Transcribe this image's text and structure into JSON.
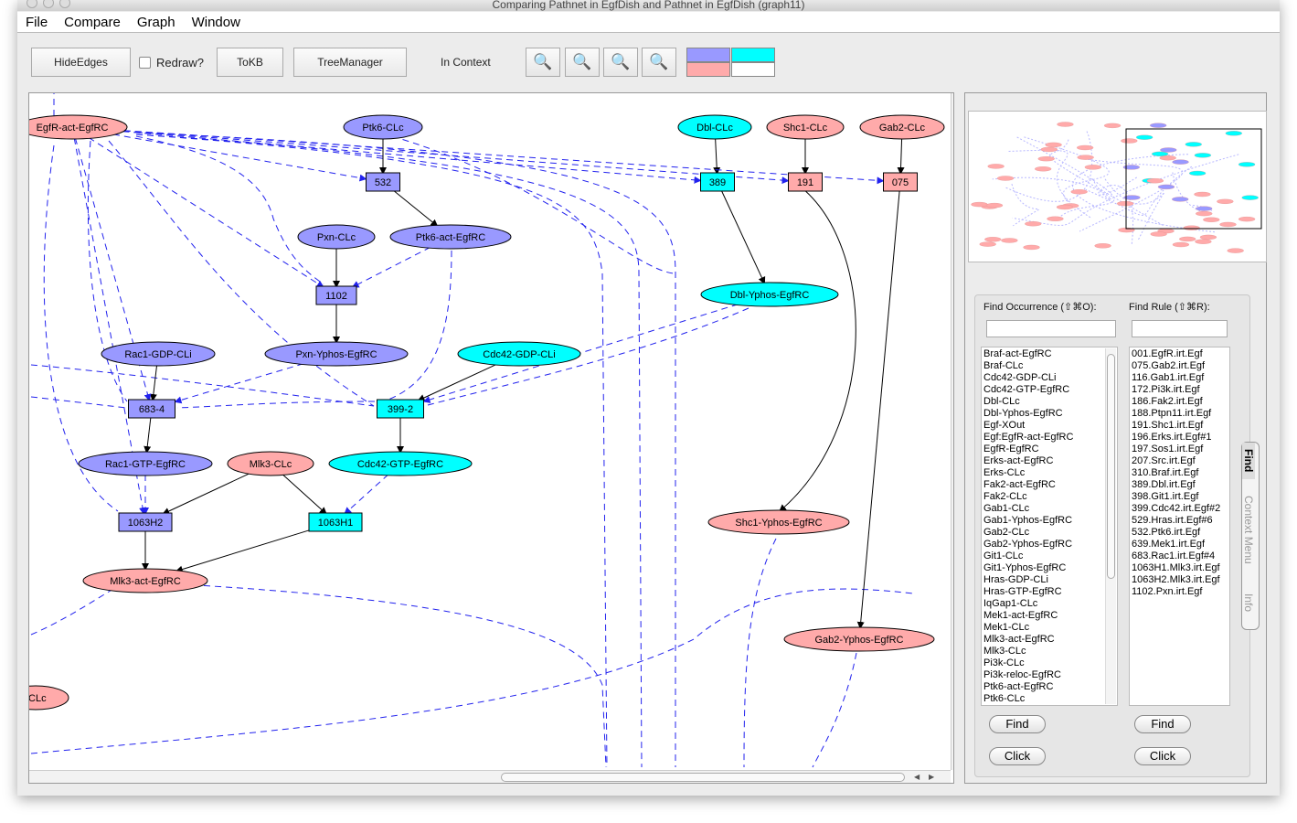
{
  "window": {
    "title": "Comparing Pathnet in EgfDish and Pathnet in EgfDish (graph11)"
  },
  "menu": [
    "File",
    "Compare",
    "Graph",
    "Window"
  ],
  "toolbar": {
    "hide_edges": "HideEdges",
    "redraw": "Redraw?",
    "redraw_checked": false,
    "tokb": "ToKB",
    "tree_manager": "TreeManager",
    "in_context": "In Context",
    "zoom_icons": [
      "zoom-in-icon",
      "zoom-out-icon",
      "zoom-fit-icon",
      "zoom-actual-icon"
    ]
  },
  "legend_colors": {
    "blue": "#9999ff",
    "cyan": "#00ffff",
    "pink": "#ffaaaa",
    "white": "#ffffff"
  },
  "graph": {
    "nodes": [
      {
        "id": "egfr",
        "label": "EgfR-act-EgfRC",
        "shape": "ellipse",
        "color": "pink"
      },
      {
        "id": "ptk6clc",
        "label": "Ptk6-CLc",
        "shape": "ellipse",
        "color": "blue"
      },
      {
        "id": "dblclc",
        "label": "Dbl-CLc",
        "shape": "ellipse",
        "color": "cyan"
      },
      {
        "id": "shc1clc",
        "label": "Shc1-CLc",
        "shape": "ellipse",
        "color": "pink"
      },
      {
        "id": "gab2clc",
        "label": "Gab2-CLc",
        "shape": "ellipse",
        "color": "pink"
      },
      {
        "id": "r532",
        "label": "532",
        "shape": "rect",
        "color": "blue"
      },
      {
        "id": "r389",
        "label": "389",
        "shape": "rect",
        "color": "cyan"
      },
      {
        "id": "r191",
        "label": "191",
        "shape": "rect",
        "color": "pink"
      },
      {
        "id": "r075",
        "label": "075",
        "shape": "rect",
        "color": "pink"
      },
      {
        "id": "pxnclc",
        "label": "Pxn-CLc",
        "shape": "ellipse",
        "color": "blue"
      },
      {
        "id": "ptk6act",
        "label": "Ptk6-act-EgfRC",
        "shape": "ellipse",
        "color": "blue"
      },
      {
        "id": "r1102",
        "label": "1102",
        "shape": "rect",
        "color": "blue"
      },
      {
        "id": "dblyp",
        "label": "Dbl-Yphos-EgfRC",
        "shape": "ellipse",
        "color": "cyan"
      },
      {
        "id": "rac1gdp",
        "label": "Rac1-GDP-CLi",
        "shape": "ellipse",
        "color": "blue"
      },
      {
        "id": "pxnyp",
        "label": "Pxn-Yphos-EgfRC",
        "shape": "ellipse",
        "color": "blue"
      },
      {
        "id": "cdc42gdp",
        "label": "Cdc42-GDP-CLi",
        "shape": "ellipse",
        "color": "cyan"
      },
      {
        "id": "r683",
        "label": "683-4",
        "shape": "rect",
        "color": "blue"
      },
      {
        "id": "r399",
        "label": "399-2",
        "shape": "rect",
        "color": "cyan"
      },
      {
        "id": "rac1gtp",
        "label": "Rac1-GTP-EgfRC",
        "shape": "ellipse",
        "color": "blue"
      },
      {
        "id": "mlk3clc",
        "label": "Mlk3-CLc",
        "shape": "ellipse",
        "color": "pink"
      },
      {
        "id": "cdc42gtp",
        "label": "Cdc42-GTP-EgfRC",
        "shape": "ellipse",
        "color": "cyan"
      },
      {
        "id": "r1063h2",
        "label": "1063H2",
        "shape": "rect",
        "color": "blue"
      },
      {
        "id": "r1063h1",
        "label": "1063H1",
        "shape": "rect",
        "color": "cyan"
      },
      {
        "id": "shc1yp",
        "label": "Shc1-Yphos-EgfRC",
        "shape": "ellipse",
        "color": "pink"
      },
      {
        "id": "mlk3act",
        "label": "Mlk3-act-EgfRC",
        "shape": "ellipse",
        "color": "pink"
      },
      {
        "id": "gab2yp",
        "label": "Gab2-Yphos-EgfRC",
        "shape": "ellipse",
        "color": "pink"
      },
      {
        "id": "clc",
        "label": "-CLc",
        "shape": "ellipse",
        "color": "pink"
      }
    ],
    "edges": [
      {
        "from": "ptk6clc",
        "to": "r532",
        "style": "solid"
      },
      {
        "from": "r532",
        "to": "ptk6act",
        "style": "solid"
      },
      {
        "from": "pxnclc",
        "to": "r1102",
        "style": "solid"
      },
      {
        "from": "r1102",
        "to": "pxnyp",
        "style": "solid"
      },
      {
        "from": "rac1gdp",
        "to": "r683",
        "style": "solid"
      },
      {
        "from": "r683",
        "to": "rac1gtp",
        "style": "solid"
      },
      {
        "from": "cdc42gdp",
        "to": "r399",
        "style": "solid"
      },
      {
        "from": "r399",
        "to": "cdc42gtp",
        "style": "solid"
      },
      {
        "from": "mlk3clc",
        "to": "r1063h2",
        "style": "solid"
      },
      {
        "from": "mlk3clc",
        "to": "r1063h1",
        "style": "solid"
      },
      {
        "from": "r1063h2",
        "to": "mlk3act",
        "style": "solid"
      },
      {
        "from": "r1063h1",
        "to": "mlk3act",
        "style": "solid"
      },
      {
        "from": "dblclc",
        "to": "r389",
        "style": "solid"
      },
      {
        "from": "r389",
        "to": "dblyp",
        "style": "solid"
      },
      {
        "from": "shc1clc",
        "to": "r191",
        "style": "solid"
      },
      {
        "from": "r191",
        "to": "shc1yp",
        "style": "solid"
      },
      {
        "from": "gab2clc",
        "to": "r075",
        "style": "solid"
      },
      {
        "from": "r075",
        "to": "gab2yp",
        "style": "solid"
      },
      {
        "from": "egfr",
        "to": "r532",
        "style": "dashed"
      },
      {
        "from": "egfr",
        "to": "r389",
        "style": "dashed"
      },
      {
        "from": "egfr",
        "to": "r191",
        "style": "dashed"
      },
      {
        "from": "egfr",
        "to": "r075",
        "style": "dashed"
      },
      {
        "from": "ptk6act",
        "to": "r1102",
        "style": "dashed"
      },
      {
        "from": "egfr",
        "to": "r1102",
        "style": "dashed"
      },
      {
        "from": "pxnyp",
        "to": "r683",
        "style": "dashed"
      },
      {
        "from": "dblyp",
        "to": "r399",
        "style": "dashed"
      },
      {
        "from": "cdc42gtp",
        "to": "r1063h1",
        "style": "dashed"
      },
      {
        "from": "rac1gtp",
        "to": "r1063h2",
        "style": "dashed"
      },
      {
        "from": "egfr",
        "to": "r683",
        "style": "dashed"
      },
      {
        "from": "egfr",
        "to": "r1063h2",
        "style": "dashed"
      }
    ]
  },
  "find": {
    "occurrence_label": "Find Occurrence (⇧⌘O):",
    "rule_label": "Find Rule (⇧⌘R):",
    "occurrence_value": "",
    "rule_value": "",
    "occurrences": [
      "Braf-act-EgfRC",
      "Braf-CLc",
      "Cdc42-GDP-CLi",
      "Cdc42-GTP-EgfRC",
      "Dbl-CLc",
      "Dbl-Yphos-EgfRC",
      "Egf-XOut",
      "Egf:EgfR-act-EgfRC",
      "EgfR-EgfRC",
      "Erks-act-EgfRC",
      "Erks-CLc",
      "Fak2-act-EgfRC",
      "Fak2-CLc",
      "Gab1-CLc",
      "Gab1-Yphos-EgfRC",
      "Gab2-CLc",
      "Gab2-Yphos-EgfRC",
      "Git1-CLc",
      "Git1-Yphos-EgfRC",
      "Hras-GDP-CLi",
      "Hras-GTP-EgfRC",
      "IqGap1-CLc",
      "Mek1-act-EgfRC",
      "Mek1-CLc",
      "Mlk3-act-EgfRC",
      "Mlk3-CLc",
      "Pi3k-CLc",
      "Pi3k-reloc-EgfRC",
      "Ptk6-act-EgfRC",
      "Ptk6-CLc"
    ],
    "rules": [
      "001.EgfR.irt.Egf",
      "075.Gab2.irt.Egf",
      "116.Gab1.irt.Egf",
      "172.Pi3k.irt.Egf",
      "186.Fak2.irt.Egf",
      "188.Ptpn11.irt.Egf",
      "191.Shc1.irt.Egf",
      "196.Erks.irt.Egf#1",
      "197.Sos1.irt.Egf",
      "207.Src.irt.Egf",
      "310.Braf.irt.Egf",
      "389.Dbl.irt.Egf",
      "398.Git1.irt.Egf",
      "399.Cdc42.irt.Egf#2",
      "529.Hras.irt.Egf#6",
      "532.Ptk6.irt.Egf",
      "639.Mek1.irt.Egf",
      "683.Rac1.irt.Egf#4",
      "1063H1.Mlk3.irt.Egf",
      "1063H2.Mlk3.irt.Egf",
      "1102.Pxn.irt.Egf"
    ],
    "find_label": "Find",
    "click_label": "Click"
  },
  "side_tabs": [
    "Find",
    "Context Menu",
    "Info"
  ],
  "active_side_tab": "Find"
}
